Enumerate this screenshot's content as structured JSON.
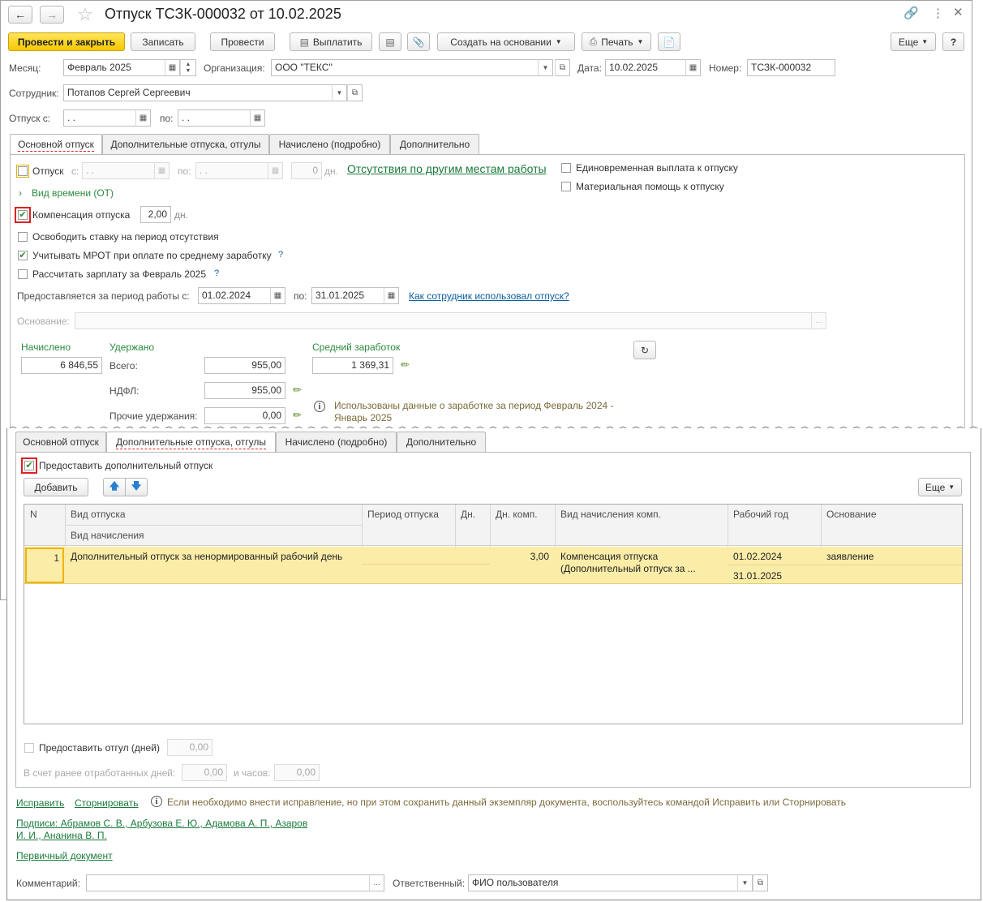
{
  "title": "Отпуск ТСЗК-000032 от 10.02.2025",
  "toolbar": {
    "post_close": "Провести и закрыть",
    "save": "Записать",
    "post": "Провести",
    "pay": "Выплатить",
    "create_based": "Создать на основании",
    "print": "Печать",
    "more": "Еще",
    "help": "?"
  },
  "header": {
    "month_label": "Месяц:",
    "month_value": "Февраль 2025",
    "org_label": "Организация:",
    "org_value": "ООО \"ТЕКС\"",
    "date_label": "Дата:",
    "date_value": "10.02.2025",
    "number_label": "Номер:",
    "number_value": "ТСЗК-000032",
    "employee_label": "Сотрудник:",
    "employee_value": "Потапов Сергей Сергеевич",
    "vac_from_label": "Отпуск с:",
    "vac_from_value": " .  .",
    "vac_to_label": "по:",
    "vac_to_value": " .  ."
  },
  "tabs": [
    "Основной отпуск",
    "Дополнительные отпуска, отгулы",
    "Начислено (подробно)",
    "Дополнительно"
  ],
  "main_tab": {
    "vacation_label": "Отпуск",
    "from_label": "с:",
    "from_value": " .  .",
    "to_label": "по:",
    "to_value": " .  .",
    "days_value": "0",
    "days_unit": "дн.",
    "other_absences_link": "Отсутствия по другим местам работы",
    "lump_sum_label": "Единовременная выплата к отпуску",
    "material_aid_label": "Материальная помощь к отпуску",
    "time_type_label": "Вид времени (ОТ)",
    "compensation_label": "Компенсация отпуска",
    "compensation_value": "2,00",
    "compensation_unit": "дн.",
    "free_rate_label": "Освободить ставку на период отсутствия",
    "mrot_label": "Учитывать МРОТ при оплате по среднему заработку",
    "calc_salary_label": "Рассчитать зарплату за Февраль 2025",
    "period_label": "Предоставляется за период работы с:",
    "period_from": "01.02.2024",
    "period_to_label": "по:",
    "period_to": "31.01.2025",
    "how_used_link": "Как сотрудник использовал отпуск?",
    "basis_label": "Основание:",
    "accrued_label": "Начислено",
    "accrued_value": "6 846,55",
    "withheld_label": "Удержано",
    "total_label": "Всего:",
    "total_value": "955,00",
    "ndfl_label": "НДФЛ:",
    "ndfl_value": "955,00",
    "other_withheld_label": "Прочие удержания:",
    "other_withheld_value": "0,00",
    "avg_earnings_label": "Средний заработок",
    "avg_earnings_value": "1 369,31",
    "info_text_1": "Использованы данные о заработке за период Февраль 2024 -",
    "info_text_2": "Январь 2025"
  },
  "add_tab": {
    "provide_additional_label": "Предоставить дополнительный отпуск",
    "add_button": "Добавить",
    "more": "Еще",
    "columns": {
      "n": "N",
      "vac_type": "Вид отпуска",
      "accrual_type": "Вид начисления",
      "period": "Период отпуска",
      "days": "Дн.",
      "comp_days": "Дн. комп.",
      "comp_accrual": "Вид начисления комп.",
      "work_year": "Рабочий год",
      "basis": "Основание"
    },
    "rows": [
      {
        "n": "1",
        "vac_type": "Дополнительный отпуск за ненормированный рабочий день",
        "comp_days": "3,00",
        "comp_accrual_1": "Компенсация отпуска",
        "comp_accrual_2": "(Дополнительный отпуск за ...",
        "year_from": "01.02.2024",
        "year_to": "31.01.2025",
        "basis": "заявление"
      }
    ],
    "time_off_label": "Предоставить отгул (дней)",
    "time_off_value": "0,00",
    "worked_days_label": "В счет ранее отработанных дней:",
    "worked_days_value": "0,00",
    "hours_label": "и часов:",
    "hours_value": "0,00"
  },
  "footer": {
    "fix_link": "Исправить",
    "storno_link": "Сторнировать",
    "fix_info": "Если необходимо внести исправление, но при этом сохранить данный экземпляр документа, воспользуйтесь командой Исправить или Сторнировать",
    "signatures_1": "Подписи: Абрамов С. В., Арбузова Е. Ю., Адамова А. П., Азаров",
    "signatures_2": "И. И., Ананина В. П.",
    "primary_doc": "Первичный документ",
    "comment_label": "Комментарий:",
    "responsible_label": "Ответственный:",
    "responsible_value": "ФИО пользователя"
  }
}
